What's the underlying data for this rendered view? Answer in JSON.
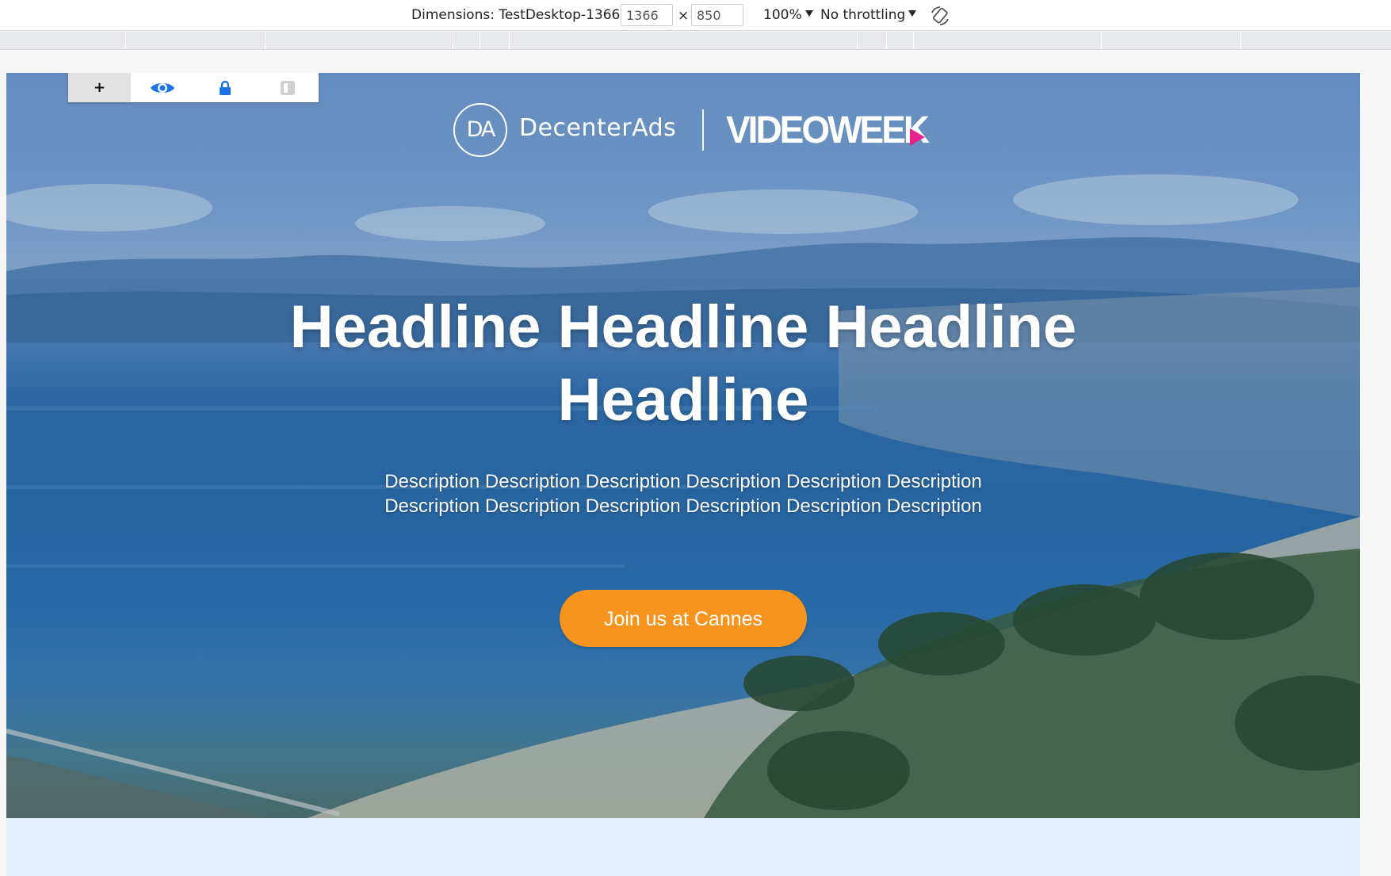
{
  "devtools": {
    "dimensions_label": "Dimensions: TestDesktop-1366",
    "width_value": "1366",
    "times": "×",
    "height_value": "850",
    "zoom": "100%",
    "throttling": "No throttling",
    "rotate_icon": "rotate-icon"
  },
  "editor_toolbar": {
    "items": [
      {
        "icon": "plus-icon",
        "glyph": "+"
      },
      {
        "icon": "eye-icon"
      },
      {
        "icon": "lock-icon"
      },
      {
        "icon": "toggle-visibility-icon"
      }
    ]
  },
  "hero": {
    "logo_primary_mark": "DA",
    "logo_primary_name": "DecenterAds",
    "logo_secondary_name": "VIDEOWEEK",
    "headline": "Headline Headline Headline Headline",
    "description": "Description Description Description Description Description Description Description Description Description Description Description Description",
    "cta_label": "Join us at Cannes"
  },
  "colors": {
    "cta": "#f7941d",
    "videoweek_play": "#e9218b",
    "below_fold": "#e3f0fd",
    "icon_blue": "#1a73e8"
  }
}
